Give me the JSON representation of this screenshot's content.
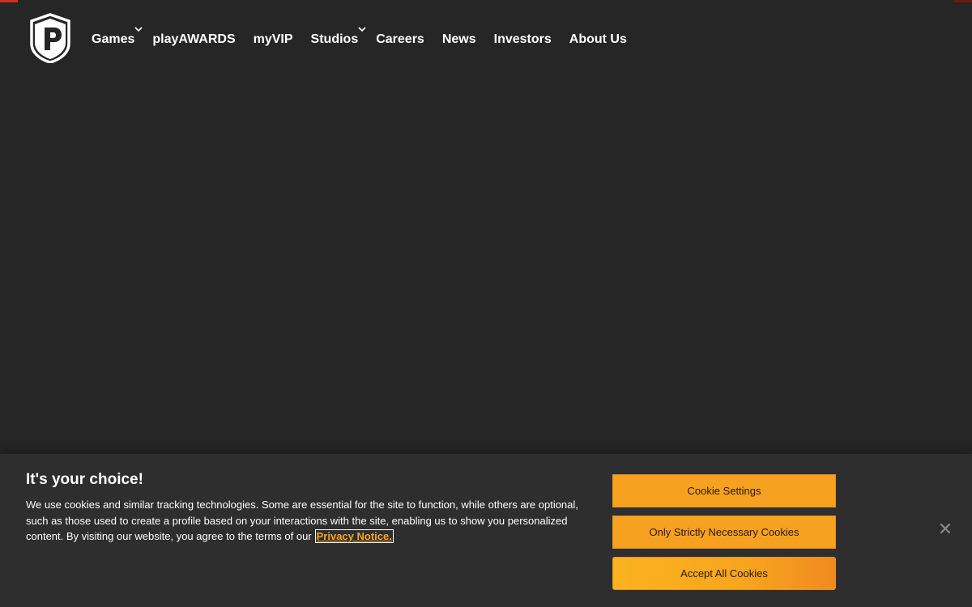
{
  "header": {
    "logo_icon": "playtika-shield-logo",
    "nav": [
      {
        "label": "Games",
        "has_dropdown": true
      },
      {
        "label": "playAWARDS",
        "has_dropdown": false
      },
      {
        "label": "myVIP",
        "has_dropdown": false
      },
      {
        "label": "Studios",
        "has_dropdown": true
      },
      {
        "label": "Careers",
        "has_dropdown": false
      },
      {
        "label": "News",
        "has_dropdown": false
      },
      {
        "label": "Investors",
        "has_dropdown": false
      },
      {
        "label": "About Us",
        "has_dropdown": false
      }
    ]
  },
  "cookie_banner": {
    "title": "It's your choice!",
    "body": "We use cookies and similar tracking technologies. Some are essential for the site to function, while others are optional, such as those used to create a profile based on your interactions with the site, enabling us to show you personalized content. By visiting our website, you agree to the terms of our",
    "privacy_link": "Privacy Notice.",
    "buttons": {
      "settings": "Cookie Settings",
      "necessary": "Only Strictly Necessary Cookies",
      "accept": "Accept All Cookies"
    },
    "close_icon": "close-icon"
  },
  "colors": {
    "background": "#262626",
    "banner_background": "#2e2e2e",
    "accent_orange": "#f6a11f",
    "corner_red": "#c8321e"
  }
}
